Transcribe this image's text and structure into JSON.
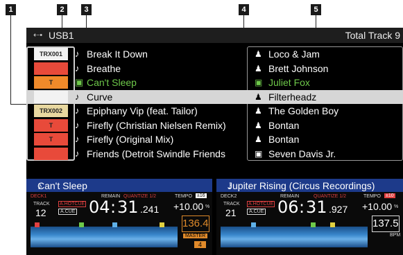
{
  "callouts": [
    "1",
    "2",
    "3",
    "4",
    "5"
  ],
  "topbar": {
    "usb_icon": "usb-icon",
    "device": "USB1",
    "total_label": "Total Track 9"
  },
  "tracks": [
    {
      "title": "Break It Down",
      "artist": "Loco & Jam",
      "art": "TRX001",
      "art_color": "#f2f2f2"
    },
    {
      "title": "Breathe",
      "artist": "Brett Johnson",
      "art": "",
      "art_color": "#e84a3a"
    },
    {
      "title": "Can't Sleep",
      "artist": "Juliet Fox",
      "art": "T",
      "art_color": "#f08a2a"
    },
    {
      "title": "Curve",
      "artist": "Filterheadz",
      "art": "",
      "art_color": "#f2f2f2"
    },
    {
      "title": "Epiphany Vip (feat. Tailor)",
      "artist": "The Golden Boy",
      "art": "TRX002",
      "art_color": "#e8d8a0"
    },
    {
      "title": "Firefly (Christian Nielsen Remix)",
      "artist": "Bontan",
      "art": "T",
      "art_color": "#e84a3a"
    },
    {
      "title": "Firefly (Original Mix)",
      "artist": "Bontan",
      "art": "T",
      "art_color": "#e84a3a"
    },
    {
      "title": "Friends (Detroit Swindle Friends",
      "artist": "Seven Davis Jr.",
      "art": "",
      "art_color": "#e84a3a"
    }
  ],
  "deck1": {
    "header": "Can't Sleep",
    "deck_label": "DECK1",
    "remain": "REMAIN",
    "quantize": "QUANTIZE 1/2",
    "tempo_label": "TEMPO",
    "tempo_range": "±16",
    "track_label": "TRACK",
    "track_no": "12",
    "hotcue": "A.HOTCUE",
    "acue": "A.CUE",
    "time_min": "04",
    "time_sec": "31",
    "time_frac": ".241",
    "tempo": "+10.00",
    "tempo_unit": "%",
    "bpm": "136.4",
    "master": "MASTER",
    "loop": "4"
  },
  "deck2": {
    "header": "Jupiter Rising (Circus Recordings)",
    "deck_label": "DECK2",
    "remain": "REMAIN",
    "quantize": "QUANTIZE 1/2",
    "tempo_label": "TEMPO",
    "tempo_range": "±10",
    "track_label": "TRACK",
    "track_no": "21",
    "hotcue": "A.HOTCUE",
    "acue": "A.CUE",
    "time_min": "06",
    "time_sec": "31",
    "time_frac": ".927",
    "tempo": "+10.00",
    "tempo_unit": "%",
    "bpm": "137.5",
    "bpm_label": "BPM"
  },
  "colors": {
    "playing": "#6ec94a",
    "deck_header": "#1d3a8a",
    "bpm": "#e08a2a"
  }
}
